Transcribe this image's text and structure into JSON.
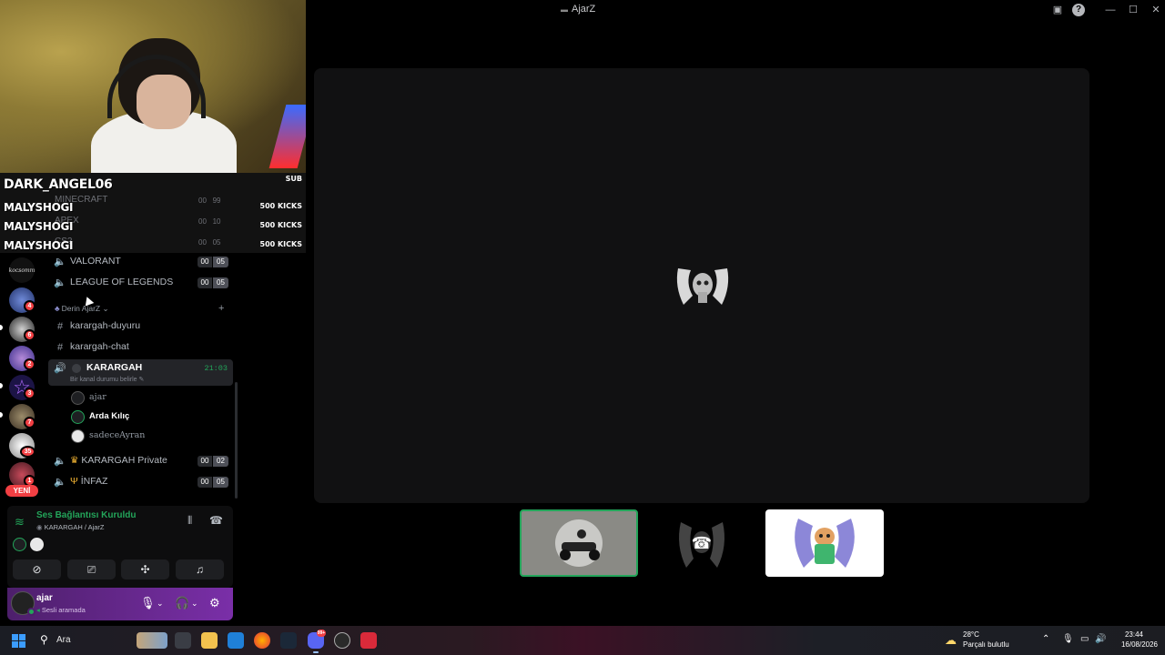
{
  "window": {
    "title": "AjarZ"
  },
  "overlay": {
    "top_alert": {
      "name": "DARK_ANGEL06",
      "tag": "SUB"
    },
    "alerts": [
      {
        "name": "MALYSHOGI",
        "amount": "500 KICKS"
      },
      {
        "name": "MALYSHOGI",
        "amount": "500 KICKS"
      },
      {
        "name": "MALYSHOGI",
        "amount": "500 KICKS"
      }
    ],
    "ghost_channels": [
      {
        "name": "MINECRAFT",
        "a": "00",
        "b": "99"
      },
      {
        "name": "APEX",
        "a": "00",
        "b": "10"
      },
      {
        "name": "CS2",
        "a": "00",
        "b": "05"
      }
    ]
  },
  "servers": {
    "text_logo": "kocsomm",
    "badges": [
      "4",
      "6",
      "2",
      "3",
      "7",
      "35",
      "1"
    ],
    "new_label": "YENİ"
  },
  "channels": {
    "voice_top": [
      {
        "name": "VALORANT",
        "a": "00",
        "b": "05"
      },
      {
        "name": "LEAGUE OF LEGENDS",
        "a": "00",
        "b": "05"
      }
    ],
    "category": "Derin AjarZ",
    "text": [
      {
        "name": "karargah-duyuru"
      },
      {
        "name": "karargah-chat"
      }
    ],
    "active": {
      "name": "KARARGAH",
      "time": "21:03",
      "status": "Bir kanal durumu belirle",
      "members": [
        "ajar",
        "Arda Kılıç",
        "sadeceAyran"
      ]
    },
    "voice_bottom": [
      {
        "name": "KARARGAH Private",
        "a": "00",
        "b": "02"
      },
      {
        "name": "İNFAZ",
        "a": "00",
        "b": "05"
      }
    ]
  },
  "voice_panel": {
    "title": "Ses Bağlantısı Kuruldu",
    "subtitle": "KARARGAH / AjarZ"
  },
  "user": {
    "name": "ajar",
    "status": "Sesli aramada"
  },
  "taskbar": {
    "search_placeholder": "Ara",
    "weather_temp": "28°C",
    "weather_desc": "Parçalı bulutlu",
    "time": "23:44",
    "date": "16/08/2026",
    "discord_badge": "99+"
  },
  "colors": {
    "online": "#23a55a",
    "danger": "#f23f43",
    "stage_bg": "#111112",
    "user_panel": "#7a2fa8"
  }
}
